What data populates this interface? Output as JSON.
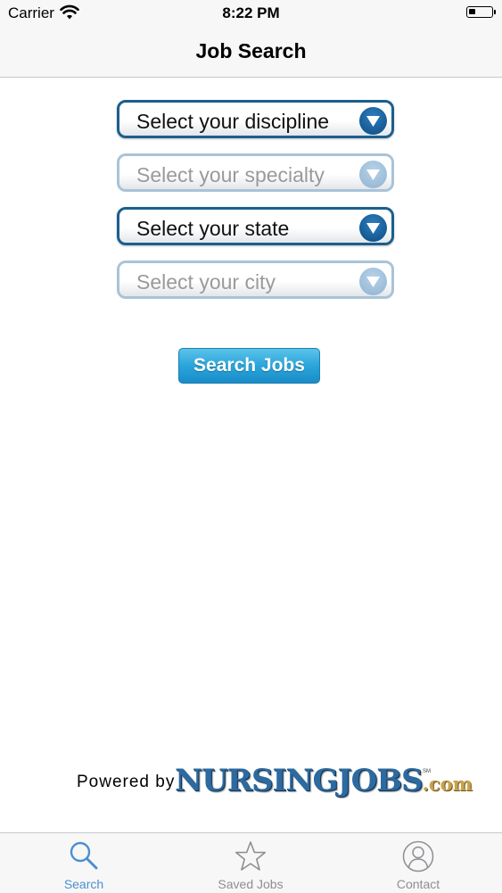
{
  "status_bar": {
    "carrier": "Carrier",
    "time": "8:22 PM",
    "battery_level": 0.3
  },
  "nav": {
    "title": "Job Search"
  },
  "form": {
    "discipline": {
      "label": "Select your discipline",
      "enabled": true
    },
    "specialty": {
      "label": "Select your specialty",
      "enabled": false
    },
    "state": {
      "label": "Select your state",
      "enabled": true
    },
    "city": {
      "label": "Select your city",
      "enabled": false
    },
    "search_button": "Search Jobs"
  },
  "footer": {
    "powered_by": "Powered by",
    "logo_main": "NURSINGJOBS",
    "logo_tld": ".com",
    "logo_mark": "SM"
  },
  "tab_bar": {
    "tabs": [
      {
        "label": "Search",
        "icon": "search-icon",
        "active": true
      },
      {
        "label": "Saved Jobs",
        "icon": "star-icon",
        "active": false
      },
      {
        "label": "Contact",
        "icon": "person-icon",
        "active": false
      }
    ]
  },
  "colors": {
    "select_border": "#1a5f8e",
    "select_border_disabled": "#a9c3d8",
    "button_blue": "#2aa5db",
    "tab_active": "#4a8fd0",
    "logo_blue": "#2d6aa0",
    "logo_gold": "#c8a24b"
  }
}
